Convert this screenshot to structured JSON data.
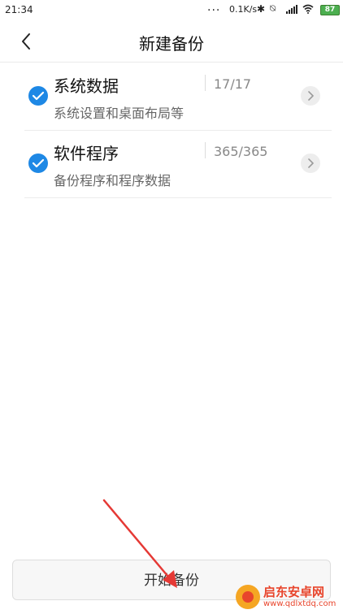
{
  "status_bar": {
    "time": "21:34",
    "dots": "...",
    "speed": "0.1K/s",
    "battery": "87",
    "icons": [
      "bluetooth-icon",
      "mute-icon",
      "signal-icon",
      "wifi-icon",
      "battery-icon"
    ]
  },
  "header": {
    "title": "新建备份",
    "back_icon": "chevron-left-icon"
  },
  "items": [
    {
      "title": "系统数据",
      "description": "系统设置和桌面布局等",
      "count": "17/17",
      "checked": true
    },
    {
      "title": "软件程序",
      "description": "备份程序和程序数据",
      "count": "365/365",
      "checked": true
    }
  ],
  "footer": {
    "start_label": "开始备份"
  },
  "watermark": {
    "name": "启东安卓网",
    "url": "www.qdlxtdq.com"
  },
  "colors": {
    "accent": "#1e88e5",
    "annotation": "#e53935",
    "battery": "#4caf50"
  }
}
